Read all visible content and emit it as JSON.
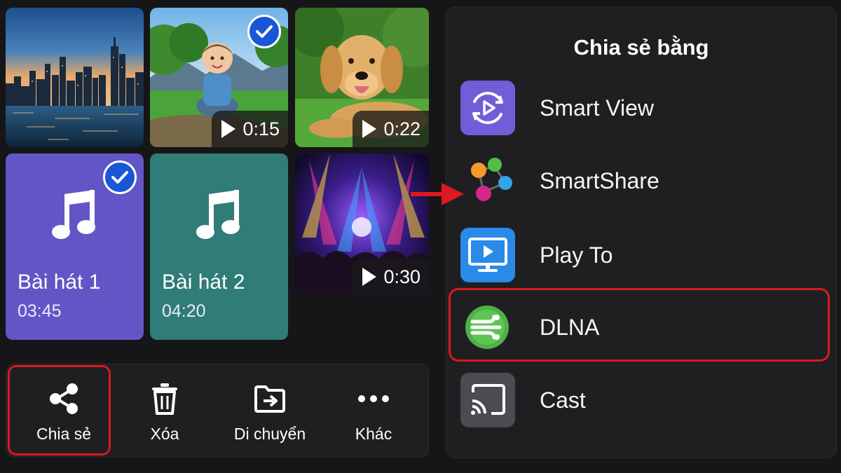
{
  "gallery": {
    "items": [
      {
        "type": "photo",
        "subject": "city skyline at dusk"
      },
      {
        "type": "video",
        "subject": "toddler sitting on grass",
        "duration": "0:15",
        "selected": true
      },
      {
        "type": "video",
        "subject": "golden retriever lying on grass",
        "duration": "0:22"
      },
      {
        "type": "audio",
        "title": "Bài hát 1",
        "length": "03:45",
        "selected": true
      },
      {
        "type": "audio",
        "title": "Bài hát 2",
        "length": "04:20"
      },
      {
        "type": "video",
        "subject": "concert stage lights and crowd",
        "duration": "0:30"
      }
    ]
  },
  "action_bar": {
    "share_label": "Chia sẻ",
    "delete_label": "Xóa",
    "move_label": "Di chuyển",
    "more_label": "Khác"
  },
  "share_sheet": {
    "title": "Chia sẻ bằng",
    "options": [
      {
        "label": "Smart View",
        "icon": "smart-view-icon"
      },
      {
        "label": "SmartShare",
        "icon": "smartshare-icon"
      },
      {
        "label": "Play To",
        "icon": "play-to-icon"
      },
      {
        "label": "DLNA",
        "icon": "dlna-icon",
        "highlighted": true
      },
      {
        "label": "Cast",
        "icon": "cast-icon"
      }
    ]
  },
  "colors": {
    "background": "#161618",
    "panel": "#1f1f21",
    "selection_blue": "#1a57d6",
    "highlight_red": "#d8191f",
    "song1_bg": "#6256c6",
    "song2_bg": "#307c77"
  }
}
